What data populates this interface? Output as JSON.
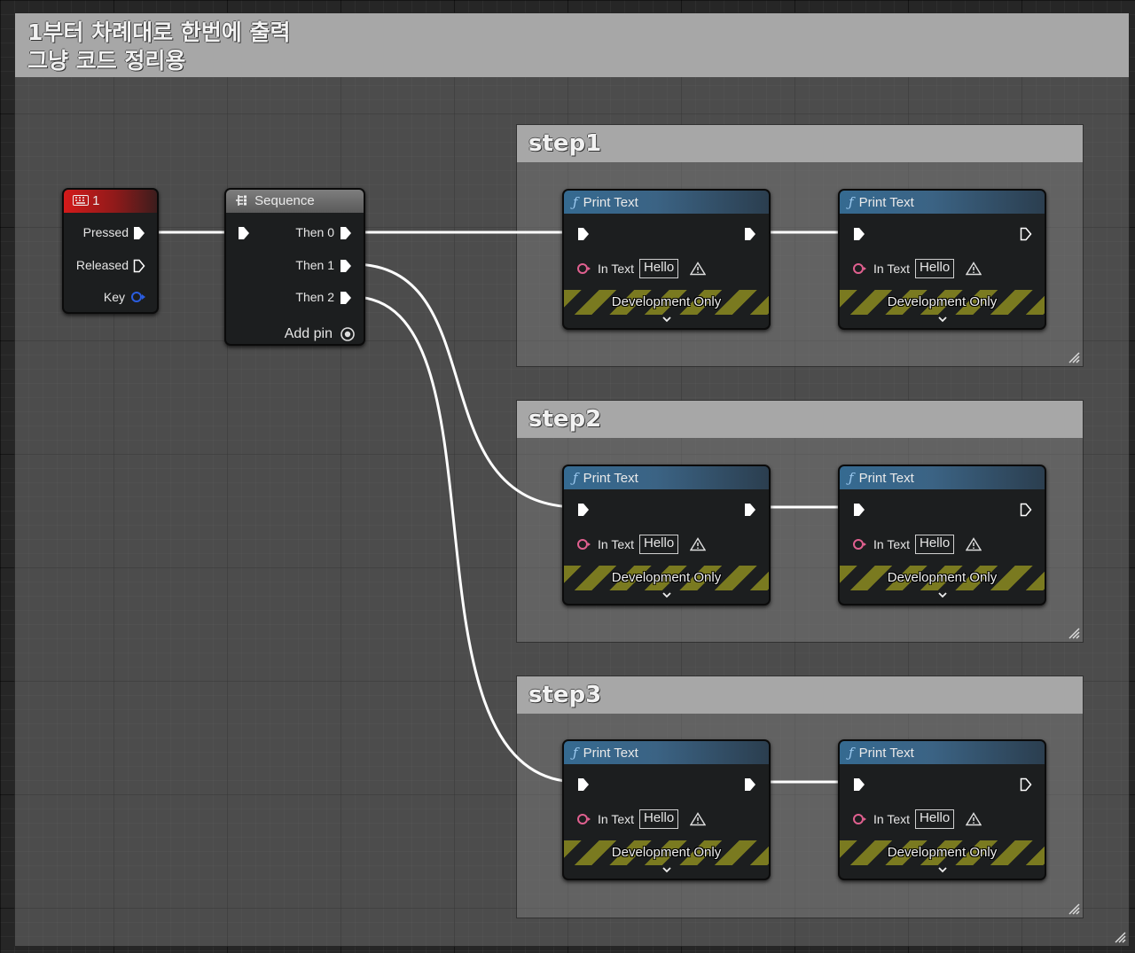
{
  "main_comment": {
    "title": "1부터 차례대로 한번에 출력\n그냥 코드 정리용"
  },
  "key_event": {
    "title": "1",
    "pins": {
      "pressed": "Pressed",
      "released": "Released",
      "key": "Key"
    }
  },
  "sequence": {
    "title": "Sequence",
    "pins": {
      "then0": "Then 0",
      "then1": "Then 1",
      "then2": "Then 2",
      "add_pin": "Add pin"
    }
  },
  "steps": [
    {
      "title": "step1",
      "nodes": [
        {
          "title": "Print Text",
          "in_text_label": "In Text",
          "in_text_value": "Hello",
          "dev_only": "Development Only"
        },
        {
          "title": "Print Text",
          "in_text_label": "In Text",
          "in_text_value": "Hello",
          "dev_only": "Development Only"
        }
      ]
    },
    {
      "title": "step2",
      "nodes": [
        {
          "title": "Print Text",
          "in_text_label": "In Text",
          "in_text_value": "Hello",
          "dev_only": "Development Only"
        },
        {
          "title": "Print Text",
          "in_text_label": "In Text",
          "in_text_value": "Hello",
          "dev_only": "Development Only"
        }
      ]
    },
    {
      "title": "step3",
      "nodes": [
        {
          "title": "Print Text",
          "in_text_label": "In Text",
          "in_text_value": "Hello",
          "dev_only": "Development Only"
        },
        {
          "title": "Print Text",
          "in_text_label": "In Text",
          "in_text_value": "Hello",
          "dev_only": "Development Only"
        }
      ]
    }
  ],
  "colors": {
    "exec_wire": "#ffffff",
    "string_pin": "#e0608f",
    "key_pin": "#2a5de0",
    "event_header": "#c81d1d",
    "function_header": "#3b6a8e"
  },
  "icons": {
    "event": "keyboard-icon",
    "sequence": "sequence-icon",
    "function": "function-icon",
    "warning": "warning-icon",
    "expand": "chevron-down-icon",
    "resize": "resize-grip-icon"
  }
}
